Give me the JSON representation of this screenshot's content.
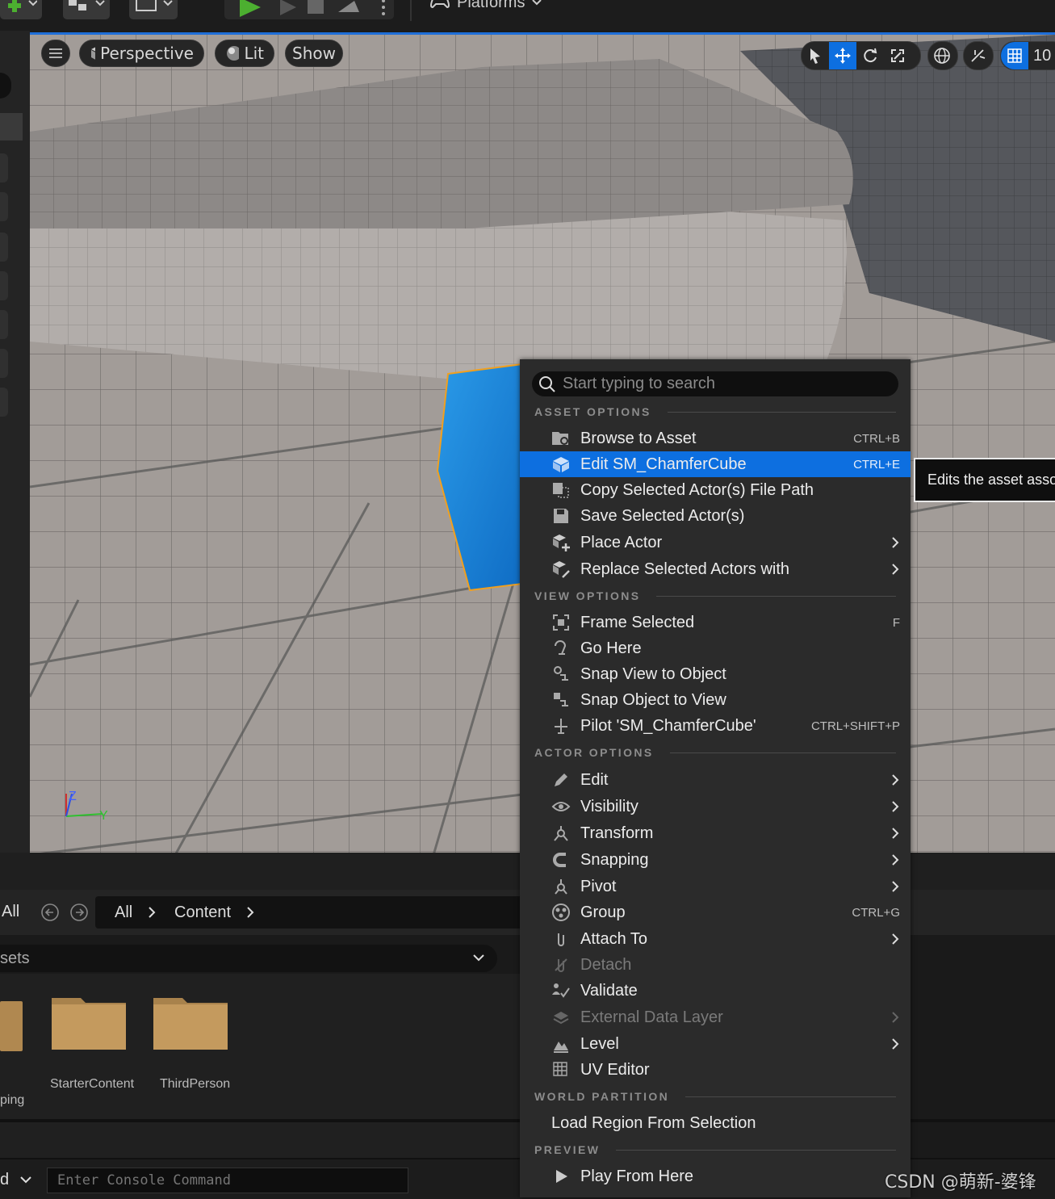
{
  "toolbar": {
    "platforms_label": "Platforms"
  },
  "viewport": {
    "menu_button": "menu-icon",
    "perspective_label": "Perspective",
    "lit_label": "Lit",
    "show_label": "Show",
    "grid_value": "10",
    "accent": "#1e6ed8"
  },
  "content_browser": {
    "filter_all": "All",
    "breadcrumb_all": "All",
    "breadcrumb_content": "Content",
    "assets_label": "sets",
    "folders": [
      {
        "name": ""
      },
      {
        "name": "StarterContent"
      },
      {
        "name": "ThirdPerson"
      }
    ],
    "partial_label": "ping",
    "cmd_selector": "d",
    "console_placeholder": "Enter Console Command"
  },
  "context_menu": {
    "search_placeholder": "Start typing to search",
    "sections": {
      "asset": "ASSET OPTIONS",
      "view": "VIEW OPTIONS",
      "actor": "ACTOR OPTIONS",
      "world": "WORLD PARTITION",
      "preview": "PREVIEW"
    },
    "items": {
      "browse": {
        "label": "Browse to Asset",
        "shortcut": "CTRL+B"
      },
      "edit_asset": {
        "label": "Edit SM_ChamferCube",
        "shortcut": "CTRL+E"
      },
      "copy_path": {
        "label": "Copy Selected Actor(s) File Path"
      },
      "save": {
        "label": "Save Selected Actor(s)"
      },
      "place": {
        "label": "Place Actor"
      },
      "replace": {
        "label": "Replace Selected Actors with"
      },
      "frame": {
        "label": "Frame Selected",
        "shortcut": "F"
      },
      "gohere": {
        "label": "Go Here"
      },
      "snapview": {
        "label": "Snap View to Object"
      },
      "snapobj": {
        "label": "Snap Object to View"
      },
      "pilot": {
        "label": "Pilot 'SM_ChamferCube'",
        "shortcut": "CTRL+SHIFT+P"
      },
      "edit": {
        "label": "Edit"
      },
      "visibility": {
        "label": "Visibility"
      },
      "transform": {
        "label": "Transform"
      },
      "snapping": {
        "label": "Snapping"
      },
      "pivot": {
        "label": "Pivot"
      },
      "group": {
        "label": "Group",
        "shortcut": "CTRL+G"
      },
      "attach": {
        "label": "Attach To"
      },
      "detach": {
        "label": "Detach"
      },
      "validate": {
        "label": "Validate"
      },
      "edl": {
        "label": "External Data Layer"
      },
      "level": {
        "label": "Level"
      },
      "uv": {
        "label": "UV Editor"
      },
      "load_region": {
        "label": "Load Region From Selection"
      },
      "play": {
        "label": "Play From Here"
      }
    },
    "highlight_color": "#0d6fe0"
  },
  "tooltip": {
    "text": "Edits the asset asso"
  },
  "watermark": "CSDN @萌新-婆锋"
}
